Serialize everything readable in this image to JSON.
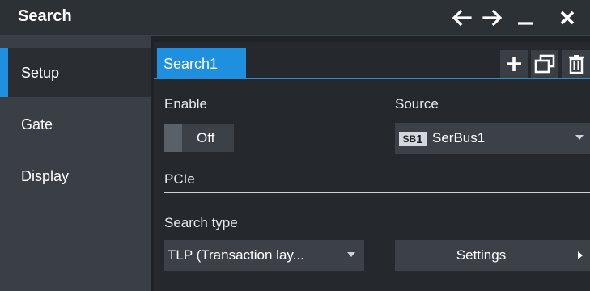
{
  "window": {
    "title": "Search",
    "buttons": [
      {
        "name": "back-icon",
        "glyph": "←"
      },
      {
        "name": "forward-icon",
        "glyph": "→"
      },
      {
        "name": "minimize-icon",
        "glyph": "—"
      },
      {
        "name": "close-icon",
        "glyph": "✕"
      }
    ]
  },
  "sidebar": {
    "items": [
      {
        "label": "Setup",
        "active": true
      },
      {
        "label": "Gate",
        "active": false
      },
      {
        "label": "Display",
        "active": false
      }
    ]
  },
  "tabs": {
    "active_label": "Search1",
    "add_icon": "+",
    "copy_icon": "copy-icon",
    "delete_icon": "trash-icon"
  },
  "setup": {
    "enable_label": "Enable",
    "enable_state": "Off",
    "source_label": "Source",
    "source_badge_prefix": "SB",
    "source_badge_num": "1",
    "source_value": "SerBus1",
    "section_label": "PCIe",
    "search_type_label": "Search type",
    "search_type_value": "TLP (Transaction lay...",
    "settings_label": "Settings"
  },
  "colors": {
    "accent": "#1f8fe0",
    "sidebar_bg": "#3a3f45",
    "content_bg": "#25292e"
  }
}
